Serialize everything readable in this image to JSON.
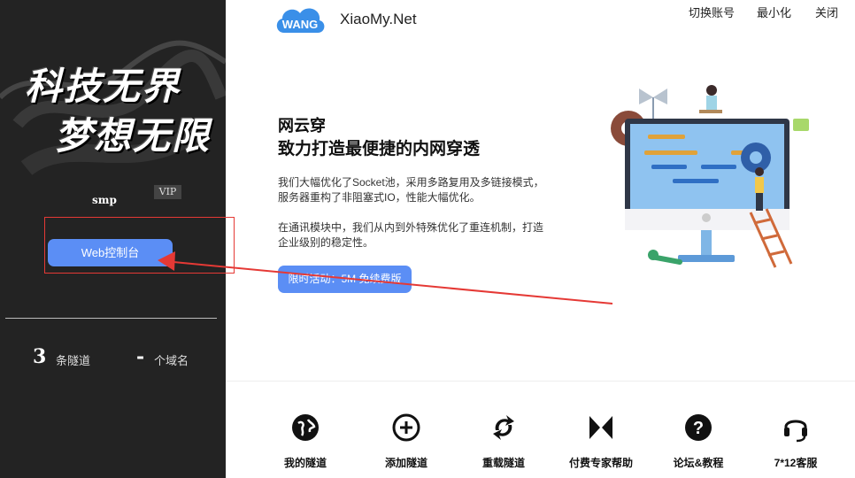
{
  "sidebar": {
    "slogan_line1": "科技无界",
    "slogan_line2": "梦想无限",
    "username": "smp",
    "vip_badge": "VIP",
    "web_console_button": "Web控制台",
    "stats": {
      "tunnels_value": "3",
      "tunnels_label": "条隧道",
      "domains_value": "-",
      "domains_label": "个域名"
    }
  },
  "header": {
    "logo_text": "WANG",
    "brand": "XiaoMy.Net",
    "switch_account": "切换账号",
    "minimize": "最小化",
    "close": "关闭"
  },
  "hero": {
    "title": "网云穿",
    "subtitle": "致力打造最便捷的内网穿透",
    "paragraph1_line1": "我们大幅优化了Socket池，采用多路复用及多链接模式，",
    "paragraph1_line2": "服务器重构了非阻塞式IO，性能大幅优化。",
    "paragraph2_line1": "在通讯模块中，我们从内到外特殊优化了重连机制，打造",
    "paragraph2_line2": "企业级别的稳定性。",
    "promo_button": "限时活动：5M 免续费版"
  },
  "actions": [
    {
      "label": "我的隧道",
      "icon": "globe-icon"
    },
    {
      "label": "添加隧道",
      "icon": "plus-circle-icon"
    },
    {
      "label": "重载隧道",
      "icon": "reload-icon"
    },
    {
      "label": "付费专家帮助",
      "icon": "expert-icon"
    },
    {
      "label": "论坛&教程",
      "icon": "question-icon"
    },
    {
      "label": "7*12客服",
      "icon": "headset-icon"
    }
  ],
  "colors": {
    "sidebar_bg": "#232323",
    "accent_blue": "#5b8ef5",
    "annotation_red": "#e53935"
  }
}
